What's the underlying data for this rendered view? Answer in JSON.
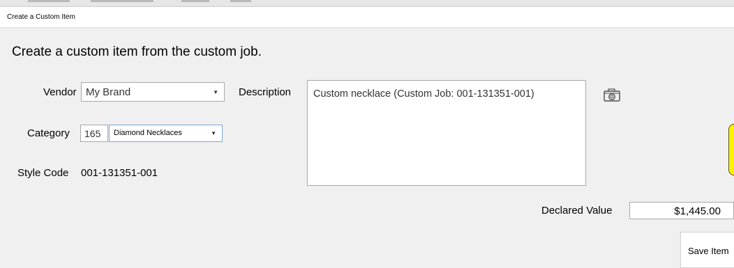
{
  "window": {
    "title": "Create a Custom Item"
  },
  "heading": "Create a custom item from the custom job.",
  "form": {
    "vendor_label": "Vendor",
    "vendor_value": "My Brand",
    "category_label": "Category",
    "category_code": "165",
    "category_value": "Diamond Necklaces",
    "style_code_label": "Style Code",
    "style_code_value": "001-131351-001",
    "description_label": "Description",
    "description_value": "Custom necklace (Custom Job: 001-131351-001)",
    "declared_value_label": "Declared Value",
    "declared_value": "$1,445.00"
  },
  "actions": {
    "save_label": "Save Item"
  },
  "icons": {
    "photo": "camera-icon",
    "dropdown": "chevron-down-icon"
  },
  "colors": {
    "background": "#f0f0f0",
    "highlight_tab": "#fff200",
    "field_border": "#a8a8a8"
  }
}
